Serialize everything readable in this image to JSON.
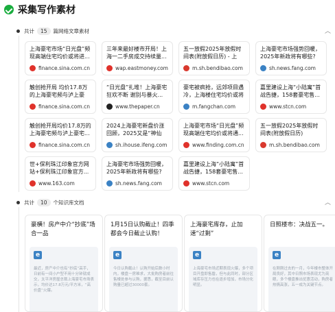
{
  "header": {
    "title": "采集写作素材"
  },
  "web_section": {
    "prefix": "共计",
    "count": "15",
    "label": "篇网络文章素材",
    "cards": [
      {
        "title": "上海豪宅市场“日光盘”频现高端住宅均价或将进...",
        "source": "finance.sina.com.cn",
        "fav": "#e0322b"
      },
      {
        "title": "三年来最好楼市开局！上海一二手房成交持续量...",
        "source": "wap.eastmoney.com",
        "fav": "#e0322b"
      },
      {
        "title": "五一放假2025年放假时间表(附放假日历) - 上海...",
        "source": "m.sh.bendibao.com",
        "fav": "#d9392e"
      },
      {
        "title": "上海豪宅市场强势回暖，2025年新政将有哪些?",
        "source": "sh.news.fang.com",
        "fav": "#3b82c4"
      },
      {
        "title": "触创抢开局 均价17.8万的上海豪宅频与泸上豪宅...",
        "source": "finance.sina.com.cn",
        "fav": "#e0322b"
      },
      {
        "title": "“日光盘”扎堆！上海豪宅狂欢不断 谢别与暴火...",
        "source": "www.thepaper.cn",
        "fav": "#222222"
      },
      {
        "title": "豪宅被疯抢，远郊项目遇冷，上海楼住宅均价或将通...",
        "source": "m.fangchan.com",
        "fav": "#3b82c4"
      },
      {
        "title": "嘉里建设上海“小陆寓”首战告捷，158套豪宅售...",
        "source": "www.stcn.com",
        "fav": "#e0322b"
      },
      {
        "title": "触创抢开局均价17.8万的上海豪宅频与泸上豪宅...",
        "source": "finance.sina.com.cn",
        "fav": "#e0322b"
      },
      {
        "title": "2024上海豪宅新盘价涨回顾，2025又是“神仙打...",
        "source": "sh.ihouse.ifeng.com",
        "fav": "#3b82c4"
      },
      {
        "title": "上海豪宅市场“日光盘”频现高端住宅均价或将通...",
        "source": "www.finding.com.cn",
        "fav": "#e0322b"
      },
      {
        "title": "五一放假2025年放假时间表(附放假日历)",
        "source": "m.sh.bendibao.com",
        "fav": "#d9392e"
      },
      {
        "title": "世+保利珠江印象官方网站+保利珠江印象官方...",
        "source": "www.163.com",
        "fav": "#e0322b"
      },
      {
        "title": "上海豪宅市场强势回暖，2025年新政将有哪些?",
        "source": "sh.news.fang.com",
        "fav": "#3b82c4"
      },
      {
        "title": "嘉里建设上海“小陆寓”首战告捷，158套豪宅售...",
        "source": "www.stcn.com",
        "fav": "#e0322b"
      }
    ]
  },
  "kb_section": {
    "prefix": "共计",
    "count": "10",
    "label": "个知识库文档",
    "cards": [
      {
        "title": "豪横！房产中介“抄底”场合一品",
        "body": "最近，房产中介也有“抄底”高手，日前有一间小户型不用十分钟就成交，太平洋房屋总裁上海豪宅市场表示，均价达17.8万元/平方米，“高价盘”火爆。"
      },
      {
        "title": "1月15日认购截止！四季都会今日截止认购！",
        "body": "今日认购截止！认购开始后数小时内，楼盘一房难求，大批购房者前往售楼处参与认购，据悉，截至目前认购量已超过30000套。"
      },
      {
        "title": "上海豪宅库存，止加速“过剩”",
        "body": "上海豪宅市场近期表现火爆，多个项目开盘即售罄，但与此同时，部分区域库存压力也在逐步增加，市场分化明显。"
      },
      {
        "title": "日照楼市：决战五一。",
        "body": "在刚刚过去的一月，今年楼市整体开局良好，其中日照市场表现尤为亮眼，多个楼盘推出优惠活动，购房者热情高涨，五一成为关键节点。"
      }
    ]
  }
}
